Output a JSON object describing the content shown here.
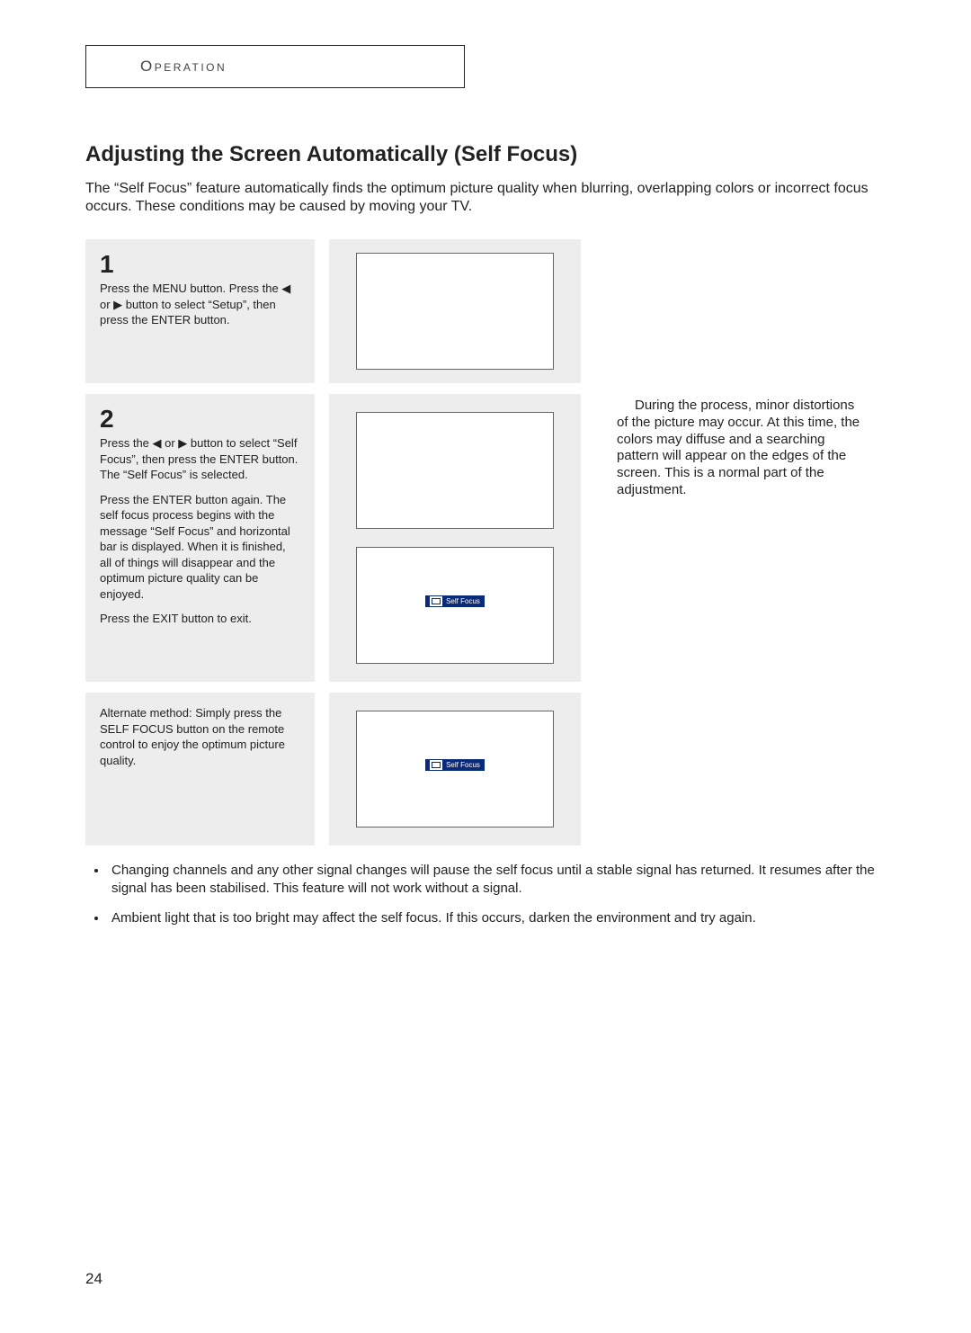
{
  "section_tab": "Operation",
  "title": "Adjusting the Screen Automatically (Self Focus)",
  "intro": "The “Self Focus” feature automatically finds the optimum picture quality when blurring, overlapping colors or incorrect focus occurs. These conditions may be caused by moving your TV.",
  "step1": {
    "num": "1",
    "text": "Press the MENU button. Press the ◀ or ▶ button to select “Setup”, then press the ENTER button."
  },
  "step2": {
    "num": "2",
    "p1": "Press the ◀ or ▶ button to select “Self Focus”, then press the ENTER button.",
    "p2": "The “Self Focus” is selected.",
    "p3": "Press the ENTER button again. The self focus process begins with the message “Self Focus” and horizontal bar is displayed. When it is finished, all of things will disappear and the optimum picture quality can be enjoyed.",
    "p4": "Press the EXIT button to exit.",
    "side_note": "During the process, minor distortions of the picture may occur. At this time, the colors may diffuse and a searching pattern will appear on the edges of the screen. This is a normal part of the adjustment.",
    "sf_label": "Self Focus"
  },
  "alt": {
    "text": "Alternate method: Simply press the SELF FOCUS button on the remote control to enjoy the optimum picture quality.",
    "sf_label": "Self Focus"
  },
  "notes": {
    "n1": "Changing channels and any other signal changes will pause the self focus until a stable signal has returned. It resumes after the signal has been stabilised. This feature will not work without a signal.",
    "n2": "Ambient light that is too bright may affect the self focus. If this occurs, darken the environment and try again."
  },
  "page_number": "24"
}
